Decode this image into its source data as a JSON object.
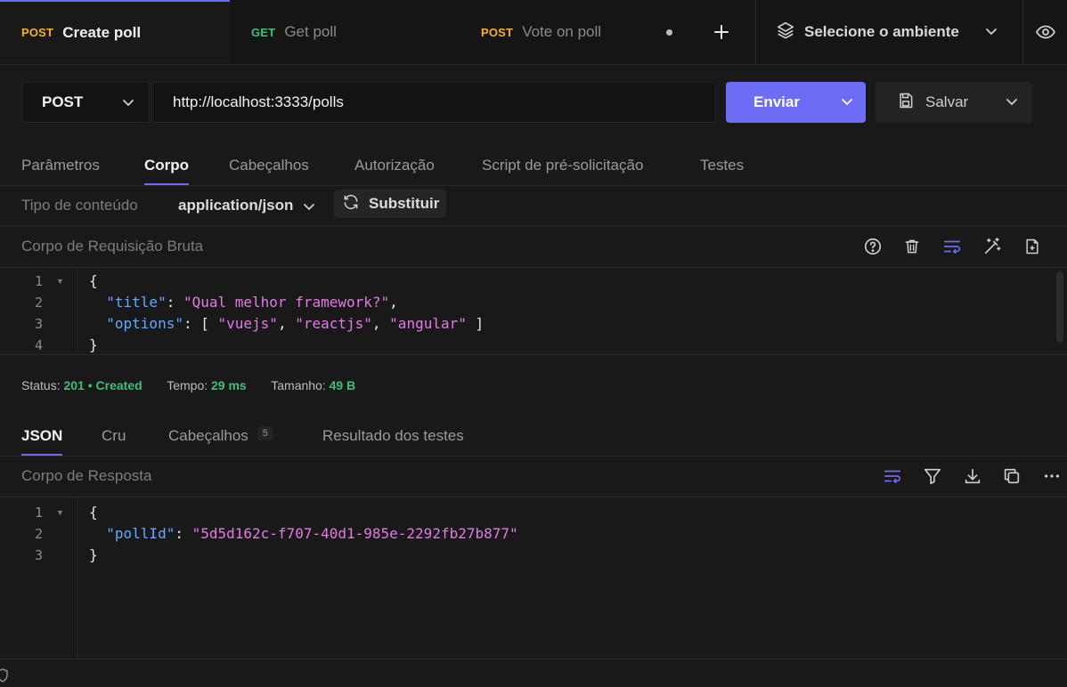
{
  "tabs": [
    {
      "method": "POST",
      "name": "Create poll",
      "active": true
    },
    {
      "method": "GET",
      "name": "Get poll",
      "active": false
    },
    {
      "method": "POST",
      "name": "Vote on poll",
      "active": false
    }
  ],
  "environment": {
    "label": "Selecione o ambiente"
  },
  "request": {
    "method": "POST",
    "url": "http://localhost:3333/polls",
    "send_label": "Enviar",
    "save_label": "Salvar"
  },
  "request_tabs": [
    "Parâmetros",
    "Corpo",
    "Cabeçalhos",
    "Autorização",
    "Script de pré-solicitação",
    "Testes"
  ],
  "content_type": {
    "label": "Tipo de conteúdo",
    "value": "application/json",
    "replace_label": "Substituir"
  },
  "raw_body": {
    "title": "Corpo de Requisição Bruta",
    "line_numbers": [
      "1",
      "2",
      "3",
      "4"
    ],
    "line1": "{",
    "key_title": "\"title\"",
    "val_title": "\"Qual melhor framework?\"",
    "key_options": "\"options\"",
    "opt1": "\"vuejs\"",
    "opt2": "\"reactjs\"",
    "opt3": "\"angular\"",
    "line4": "}"
  },
  "status_bar": {
    "status_label": "Status:",
    "status_code": "201",
    "status_text": "Created",
    "time_label": "Tempo:",
    "time_value": "29 ms",
    "size_label": "Tamanho:",
    "size_value": "49 B"
  },
  "response_tabs": {
    "json": "JSON",
    "raw": "Cru",
    "headers": "Cabeçalhos",
    "headers_count": "5",
    "tests": "Resultado dos testes"
  },
  "response_body": {
    "title": "Corpo de Resposta",
    "line_numbers": [
      "1",
      "2",
      "3"
    ],
    "line1": "{",
    "key_pollId": "\"pollId\"",
    "val_pollId": "\"5d5d162c-f707-40d1-985e-2292fb27b877\"",
    "line3": "}"
  },
  "colors": {
    "accent": "#6c6cf5",
    "post": "#f5b32a",
    "get": "#3fbf7a",
    "key": "#64a8ff",
    "string": "#e27be8",
    "success": "#3fbf7a"
  }
}
